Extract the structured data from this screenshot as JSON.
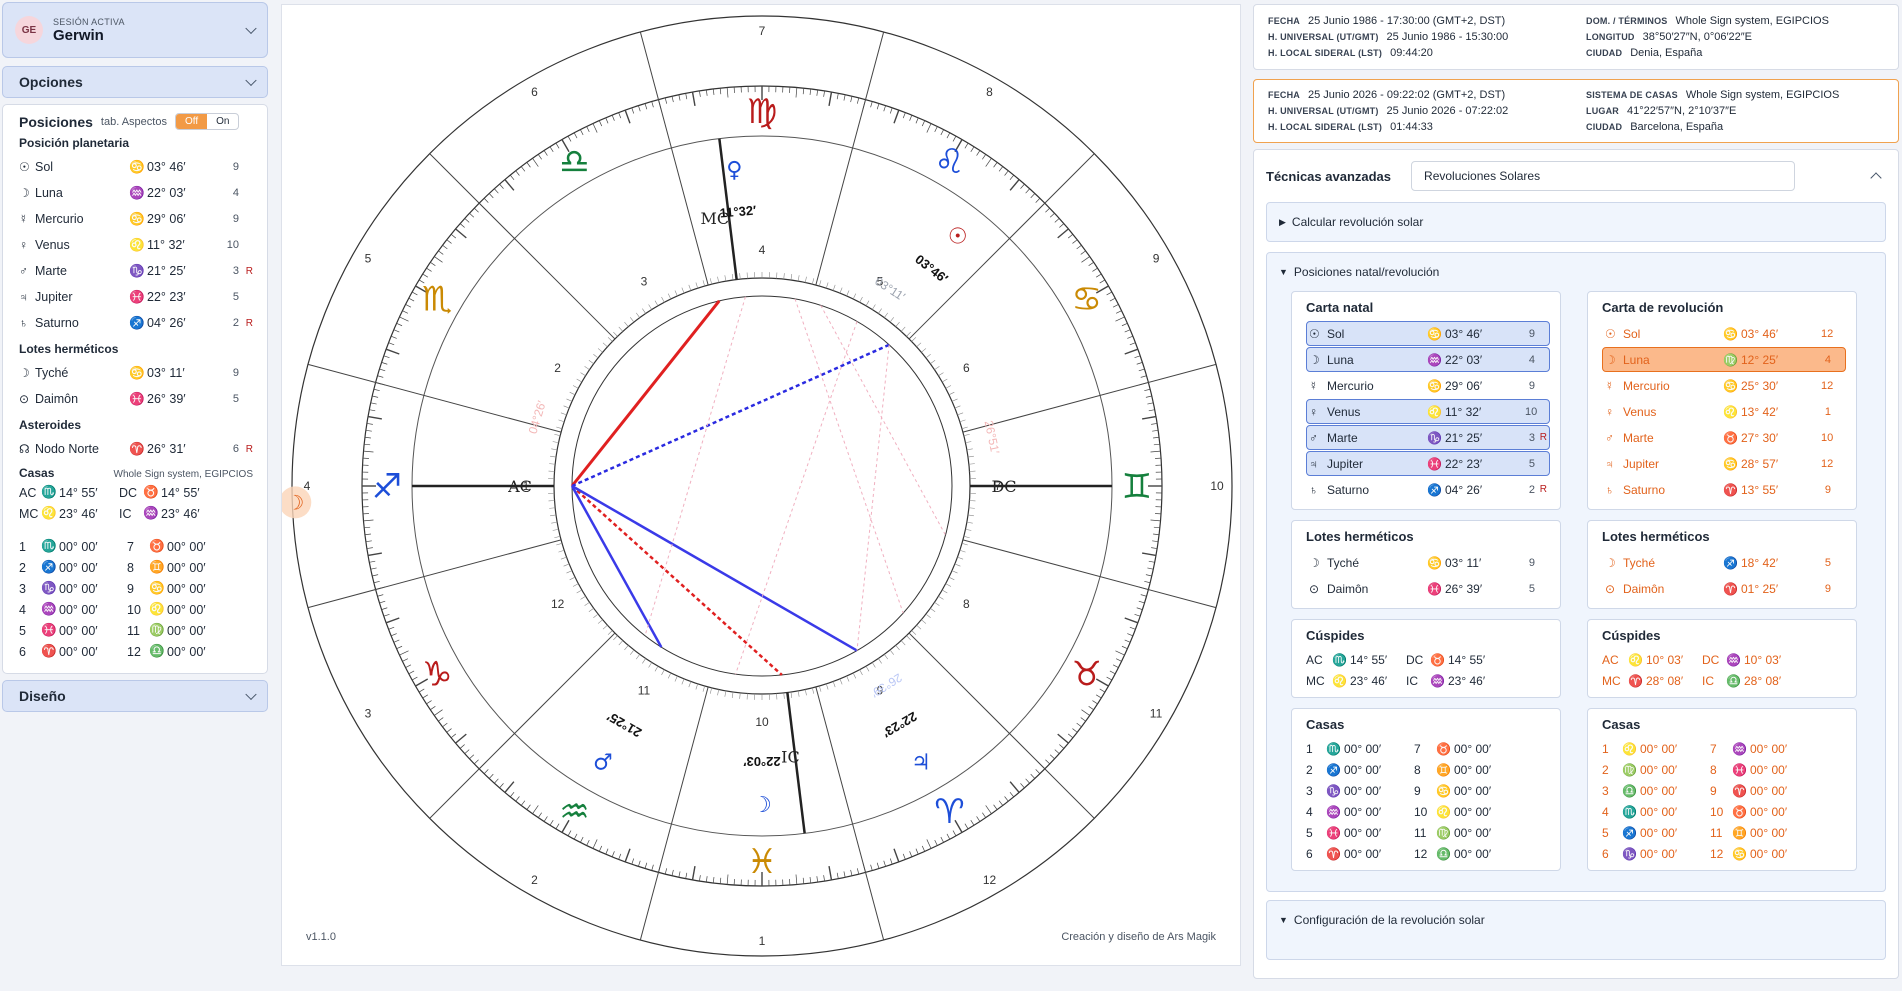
{
  "session": {
    "label": "SESIÓN ACTIVA",
    "initials": "GE",
    "name": "Gerwin"
  },
  "opciones_label": "Opciones",
  "diseno_label": "Diseño",
  "positions": {
    "title": "Posiciones",
    "aspect_label": "tab. Aspectos",
    "toggle": [
      "Off",
      "On"
    ],
    "planet_header": "Posición planetaria",
    "planets": [
      {
        "g": "☉",
        "name": "Sol",
        "sg": "♋",
        "deg": "03° 46′",
        "h": "9",
        "r": ""
      },
      {
        "g": "☽",
        "name": "Luna",
        "sg": "♒",
        "deg": "22° 03′",
        "h": "4",
        "r": ""
      },
      {
        "g": "☿",
        "name": "Mercurio",
        "sg": "♋",
        "deg": "29° 06′",
        "h": "9",
        "r": ""
      },
      {
        "g": "♀",
        "name": "Venus",
        "sg": "♌",
        "deg": "11° 32′",
        "h": "10",
        "r": ""
      },
      {
        "g": "♂",
        "name": "Marte",
        "sg": "♑",
        "deg": "21° 25′",
        "h": "3",
        "r": "R"
      },
      {
        "g": "♃",
        "name": "Jupiter",
        "sg": "♓",
        "deg": "22° 23′",
        "h": "5",
        "r": ""
      },
      {
        "g": "♄",
        "name": "Saturno",
        "sg": "♐",
        "deg": "04° 26′",
        "h": "2",
        "r": "R"
      }
    ],
    "lots_header": "Lotes herméticos",
    "lots": [
      {
        "g": "☽",
        "name": "Tyché",
        "sg": "♋",
        "deg": "03° 11′",
        "h": "9",
        "r": ""
      },
      {
        "g": "⊙",
        "name": "Daimôn",
        "sg": "♓",
        "deg": "26° 39′",
        "h": "5",
        "r": ""
      }
    ],
    "ast_header": "Asteroides",
    "asteroids": [
      {
        "g": "☊",
        "name": "Nodo Norte",
        "sg": "♈",
        "deg": "26° 31′",
        "h": "6",
        "r": "R"
      }
    ],
    "houses_header": "Casas",
    "houses_system": "Whole Sign system, EGIPCIOS",
    "angles": [
      {
        "a": "AC",
        "sa": "♏",
        "da": "14° 55′",
        "b": "DC",
        "sb": "♉",
        "db": "14° 55′"
      },
      {
        "a": "MC",
        "sa": "♌",
        "da": "23° 46′",
        "b": "IC",
        "sb": "♒",
        "db": "23° 46′"
      }
    ],
    "houses": [
      {
        "a": "1",
        "sa": "♏",
        "da": "00° 00′",
        "b": "7",
        "sb": "♉",
        "db": "00° 00′"
      },
      {
        "a": "2",
        "sa": "♐",
        "da": "00° 00′",
        "b": "8",
        "sb": "♊",
        "db": "00° 00′"
      },
      {
        "a": "3",
        "sa": "♑",
        "da": "00° 00′",
        "b": "9",
        "sb": "♋",
        "db": "00° 00′"
      },
      {
        "a": "4",
        "sa": "♒",
        "da": "00° 00′",
        "b": "10",
        "sb": "♌",
        "db": "00° 00′"
      },
      {
        "a": "5",
        "sa": "♓",
        "da": "00° 00′",
        "b": "11",
        "sb": "♍",
        "db": "00° 00′"
      },
      {
        "a": "6",
        "sa": "♈",
        "da": "00° 00′",
        "b": "12",
        "sb": "♎",
        "db": "00° 00′"
      }
    ]
  },
  "chart": {
    "version": "v1.1.0",
    "credit": "Creación y diseño de Ars Magik",
    "angle_labels": {
      "ac": "AC",
      "dc": "DC",
      "mc": "MC",
      "ic": "IC"
    },
    "planet_labels": {
      "venus": "11°32′",
      "sun": "03°46′",
      "jupiter": "22°23′",
      "moon": "22°03′",
      "mars": "21°25′",
      "rev_sun": "03°11′",
      "saturn_faint": "04°26′",
      "node_faint": "26°51′",
      "jup_faint": "26°39′"
    }
  },
  "natal_info": {
    "fecha_label": "FECHA",
    "fecha": "25 Junio 1986 - 17:30:00 (GMT+2, DST)",
    "hu_label": "H. UNIVERSAL (UT/GMT)",
    "hu": "25 Junio 1986 - 15:30:00",
    "hl_label": "H. LOCAL SIDERAL (LST)",
    "hl": "09:44:20",
    "dom_label": "DOM. / TÉRMINOS",
    "dom": "Whole Sign system, EGIPCIOS",
    "lon_label": "LONGITUD",
    "lon": "38°50′27″N, 0°06′22″E",
    "ciudad_label": "CIUDAD",
    "ciudad": "Denia, España"
  },
  "rev_info": {
    "fecha_label": "FECHA",
    "fecha": "25 Junio 2026 - 09:22:02 (GMT+2, DST)",
    "hu_label": "H. UNIVERSAL (UT/GMT)",
    "hu": "25 Junio 2026 - 07:22:02",
    "hl_label": "H. LOCAL SIDERAL (LST)",
    "hl": "01:44:33",
    "sis_label": "SISTEMA DE CASAS",
    "sis": "Whole Sign system, EGIPCIOS",
    "lugar_label": "LUGAR",
    "lugar": "41°22′57″N, 2°10′37″E",
    "ciudad_label": "CIUDAD",
    "ciudad": "Barcelona, España"
  },
  "tech": {
    "label": "Técnicas avanzadas",
    "select": "Revoluciones Solares",
    "calc": "Calcular revolución solar",
    "pos": "Posiciones natal/revolución",
    "config": "Configuración de la revolución solar",
    "natal_title": "Carta natal",
    "rev_title": "Carta de revolución",
    "lots_title": "Lotes herméticos",
    "cusp_title": "Cúspides",
    "houses_title": "Casas",
    "rev_planets": [
      {
        "g": "☉",
        "name": "Sol",
        "sg": "♋",
        "deg": "03° 46′",
        "h": "12",
        "r": ""
      },
      {
        "g": "☽",
        "name": "Luna",
        "sg": "♍",
        "deg": "12° 25′",
        "h": "4",
        "r": ""
      },
      {
        "g": "☿",
        "name": "Mercurio",
        "sg": "♋",
        "deg": "25° 30′",
        "h": "12",
        "r": ""
      },
      {
        "g": "♀",
        "name": "Venus",
        "sg": "♌",
        "deg": "13° 42′",
        "h": "1",
        "r": ""
      },
      {
        "g": "♂",
        "name": "Marte",
        "sg": "♉",
        "deg": "27° 30′",
        "h": "10",
        "r": ""
      },
      {
        "g": "♃",
        "name": "Jupiter",
        "sg": "♋",
        "deg": "28° 57′",
        "h": "12",
        "r": ""
      },
      {
        "g": "♄",
        "name": "Saturno",
        "sg": "♈",
        "deg": "13° 55′",
        "h": "9",
        "r": ""
      }
    ],
    "rev_lots": [
      {
        "g": "☽",
        "name": "Tyché",
        "sg": "♐",
        "deg": "18° 42′",
        "h": "5",
        "r": ""
      },
      {
        "g": "⊙",
        "name": "Daimôn",
        "sg": "♈",
        "deg": "01° 25′",
        "h": "9",
        "r": ""
      }
    ],
    "rev_angles": [
      {
        "a": "AC",
        "sa": "♌",
        "da": "10° 03′",
        "b": "DC",
        "sb": "♒",
        "db": "10° 03′"
      },
      {
        "a": "MC",
        "sa": "♈",
        "da": "28° 08′",
        "b": "IC",
        "sb": "♎",
        "db": "28° 08′"
      }
    ],
    "rev_houses": [
      {
        "a": "1",
        "sa": "♌",
        "da": "00° 00′",
        "b": "7",
        "sb": "♒",
        "db": "00° 00′"
      },
      {
        "a": "2",
        "sa": "♍",
        "da": "00° 00′",
        "b": "8",
        "sb": "♓",
        "db": "00° 00′"
      },
      {
        "a": "3",
        "sa": "♎",
        "da": "00° 00′",
        "b": "9",
        "sb": "♈",
        "db": "00° 00′"
      },
      {
        "a": "4",
        "sa": "♏",
        "da": "00° 00′",
        "b": "10",
        "sb": "♉",
        "db": "00° 00′"
      },
      {
        "a": "5",
        "sa": "♐",
        "da": "00° 00′",
        "b": "11",
        "sb": "♊",
        "db": "00° 00′"
      },
      {
        "a": "6",
        "sa": "♑",
        "da": "00° 00′",
        "b": "12",
        "sb": "♋",
        "db": "00° 00′"
      }
    ]
  },
  "colors": {
    "accent": "#f29a45",
    "natal_hl": "#d8e3f8",
    "rev_hl": "#fbb98b",
    "rev_text": "#e2621b"
  }
}
